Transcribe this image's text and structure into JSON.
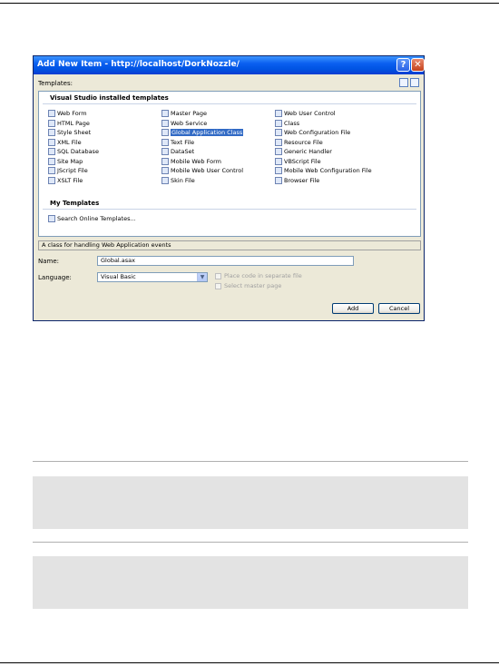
{
  "dialog": {
    "title": "Add New Item - http://localhost/DorkNozzle/",
    "help_glyph": "?",
    "close_glyph": "✕",
    "templates_label": "Templates:",
    "group_installed": "Visual Studio installed templates",
    "group_my": "My Templates",
    "col1": [
      "Web Form",
      "HTML Page",
      "Style Sheet",
      "XML File",
      "SQL Database",
      "Site Map",
      "JScript File",
      "XSLT File"
    ],
    "col2": [
      "Master Page",
      "Web Service",
      "Global Application Class",
      "Text File",
      "DataSet",
      "Mobile Web Form",
      "Mobile Web User Control",
      "Skin File"
    ],
    "col3": [
      "Web User Control",
      "Class",
      "Web Configuration File",
      "Resource File",
      "Generic Handler",
      "VBScript File",
      "Mobile Web Configuration File",
      "Browser File"
    ],
    "selected_item": "Global Application Class",
    "my_templates": [
      "Search Online Templates..."
    ],
    "description": "A class for handling Web Application events",
    "name_label": "Name:",
    "name_value": "Global.asax",
    "language_label": "Language:",
    "language_value": "Visual Basic",
    "check_separate": "Place code in separate file",
    "check_master": "Select master page",
    "add_button": "Add",
    "cancel_button": "Cancel"
  }
}
